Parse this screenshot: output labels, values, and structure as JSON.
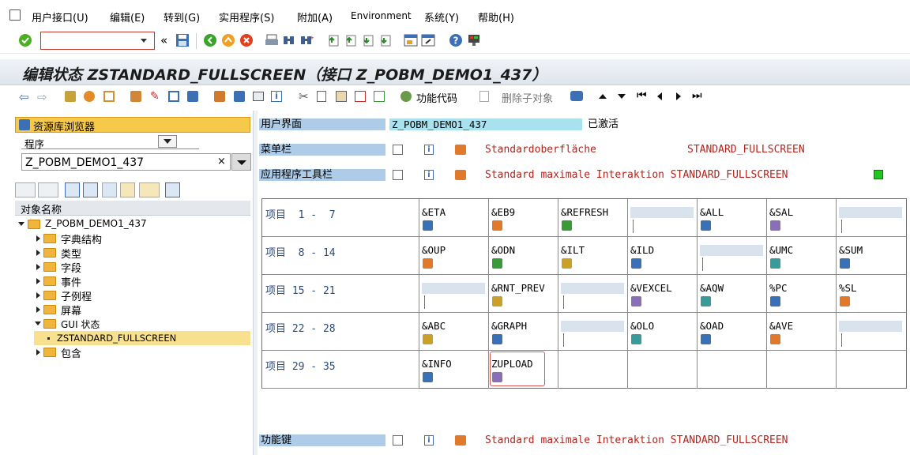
{
  "menu": {
    "items": [
      "用户接口(U)",
      "编辑(E)",
      "转到(G)",
      "实用程序(S)",
      "附加(A)",
      "Environment",
      "系统(Y)",
      "帮助(H)"
    ]
  },
  "title": "编辑状态 ZSTANDARD_FULLSCREEN（接口 Z_POBM_DEMO1_437）",
  "apptoolbar": {
    "function_code": "功能代码",
    "delete_subobject": "删除子对象"
  },
  "repository": {
    "title": "资源库浏览器",
    "object_type": "程序",
    "object_name": "Z_POBM_DEMO1_437",
    "header": "对象名称",
    "tree": [
      {
        "label": "Z_POBM_DEMO1_437",
        "level": 0,
        "expanded": true
      },
      {
        "label": "字典结构",
        "level": 1,
        "expanded": false
      },
      {
        "label": "类型",
        "level": 1,
        "expanded": false
      },
      {
        "label": "字段",
        "level": 1,
        "expanded": false
      },
      {
        "label": "事件",
        "level": 1,
        "expanded": false
      },
      {
        "label": "子例程",
        "level": 1,
        "expanded": false
      },
      {
        "label": "屏幕",
        "level": 1,
        "expanded": false
      },
      {
        "label": "GUI 状态",
        "level": 1,
        "expanded": true
      },
      {
        "label": "ZSTANDARD_FULLSCREEN",
        "level": 2,
        "selected": true
      },
      {
        "label": "包含",
        "level": 1,
        "expanded": false
      }
    ]
  },
  "ui": {
    "label": "用户界面",
    "value": "Z_POBM_DEMO1_437",
    "status": "已激活"
  },
  "menubar_row": {
    "label": "菜单栏",
    "text1": "Standardoberfläche",
    "text2": "STANDARD_FULLSCREEN"
  },
  "apptoolbar_row": {
    "label": "应用程序工具栏",
    "text": "Standard maximale Interaktion STANDARD_FULLSCREEN"
  },
  "funckeys_row": {
    "label": "功能键",
    "text": "Standard maximale Interaktion STANDARD_FULLSCREEN"
  },
  "grid": {
    "rows": [
      {
        "label": "项目  1 -  7",
        "items": [
          "&ETA",
          "&EB9",
          "&REFRESH",
          "",
          "&ALL",
          "&SAL",
          ""
        ]
      },
      {
        "label": "项目  8 - 14",
        "items": [
          "&OUP",
          "&ODN",
          "&ILT",
          "&ILD",
          "",
          "&UMC",
          "&SUM"
        ]
      },
      {
        "label": "项目 15 - 21",
        "items": [
          "",
          "&RNT_PREV",
          "",
          "&VEXCEL",
          "&AQW",
          "%PC",
          "%SL"
        ]
      },
      {
        "label": "项目 22 - 28",
        "items": [
          "&ABC",
          "&GRAPH",
          "",
          "&OLO",
          "&OAD",
          "&AVE",
          ""
        ]
      },
      {
        "label": "项目 29 - 35",
        "items": [
          "&INFO",
          "ZUPLOAD",
          "",
          "",
          "",
          "",
          ""
        ]
      }
    ]
  },
  "colors": {
    "label_bar": "#aecbe8",
    "selected_border": "#d9534f",
    "active_green": "#22c522"
  }
}
